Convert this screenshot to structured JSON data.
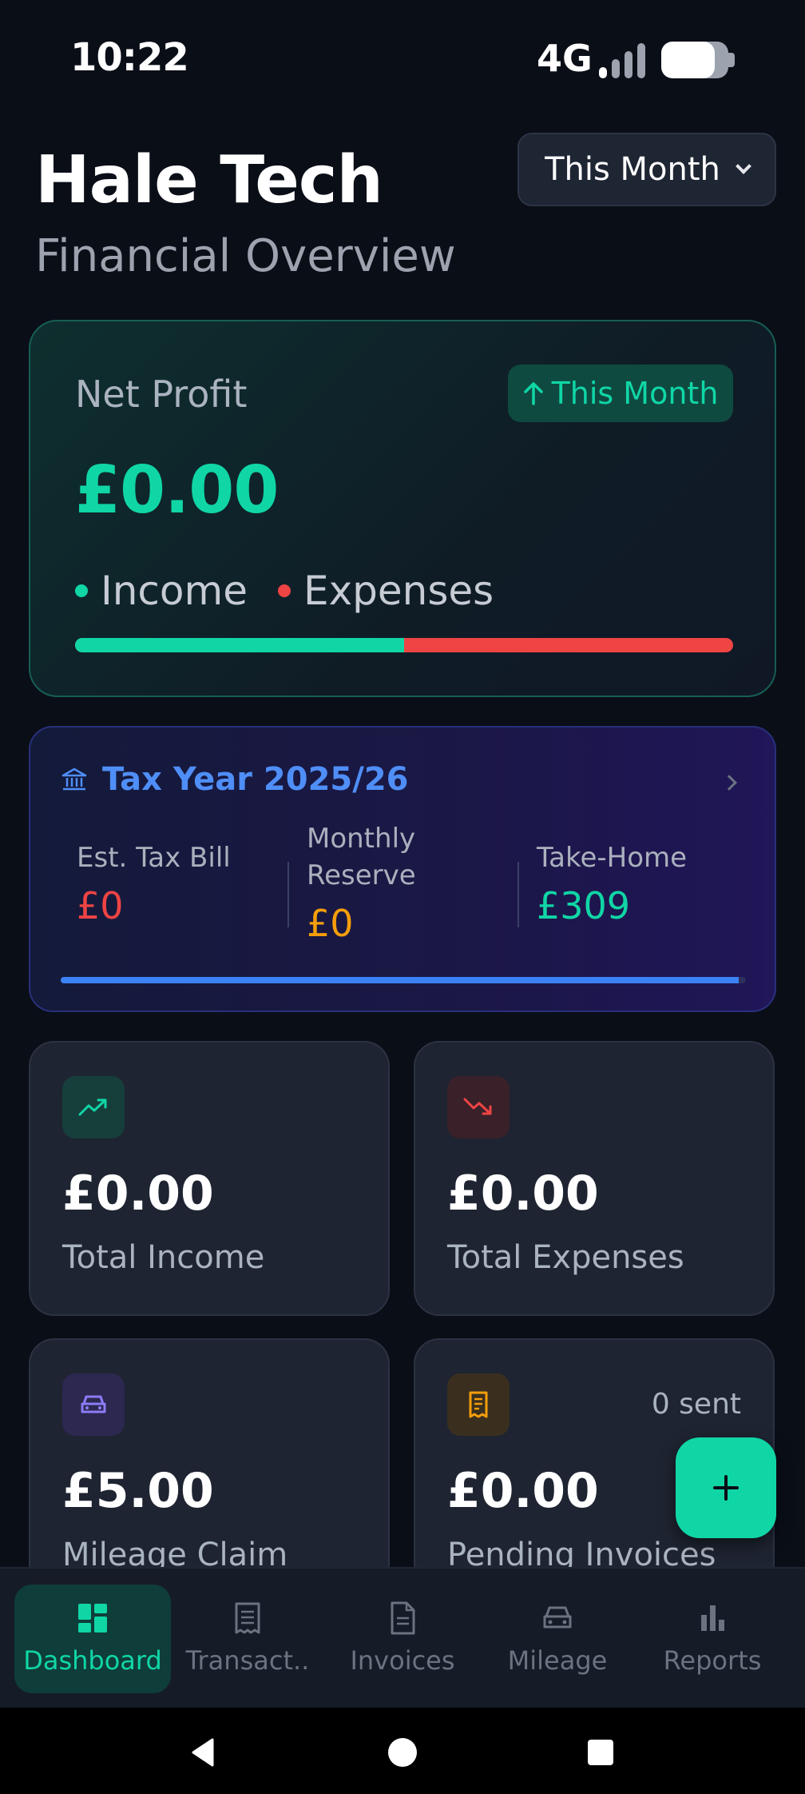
{
  "status": {
    "time": "10:22",
    "network": "4G",
    "battery_level": 0.8
  },
  "header": {
    "title": "Hale Tech",
    "subtitle": "Financial Overview",
    "period_button": "This Month"
  },
  "net_profit": {
    "label": "Net Profit",
    "badge": "This Month",
    "value": "£0.00",
    "legend_income": "Income",
    "legend_expenses": "Expenses",
    "income_share": 0.5,
    "colors": {
      "income": "#10d6a6",
      "expenses": "#ef4444"
    }
  },
  "tax": {
    "title": "Tax Year 2025/26",
    "est_label": "Est. Tax Bill",
    "est_value": "£0",
    "reserve_label_1": "Monthly",
    "reserve_label_2": "Reserve",
    "reserve_value": "£0",
    "takehome_label": "Take-Home",
    "takehome_value": "£309",
    "progress": 0.99
  },
  "stats": [
    {
      "icon": "trend-up-icon",
      "amount": "£0.00",
      "label": "Total Income"
    },
    {
      "icon": "trend-down-icon",
      "amount": "£0.00",
      "label": "Total Expenses"
    },
    {
      "icon": "car-icon",
      "amount": "£5.00",
      "label": "Mileage Claim"
    },
    {
      "icon": "receipt-icon",
      "amount": "£0.00",
      "label": "Pending Invoices",
      "extra": "0 sent"
    }
  ],
  "tabs": [
    {
      "label": "Dashboard",
      "icon": "dashboard-icon",
      "active": true
    },
    {
      "label": "Transact..",
      "icon": "receipt-icon"
    },
    {
      "label": "Invoices",
      "icon": "document-icon"
    },
    {
      "label": "Mileage",
      "icon": "car-icon"
    },
    {
      "label": "Reports",
      "icon": "bar-chart-icon"
    }
  ]
}
